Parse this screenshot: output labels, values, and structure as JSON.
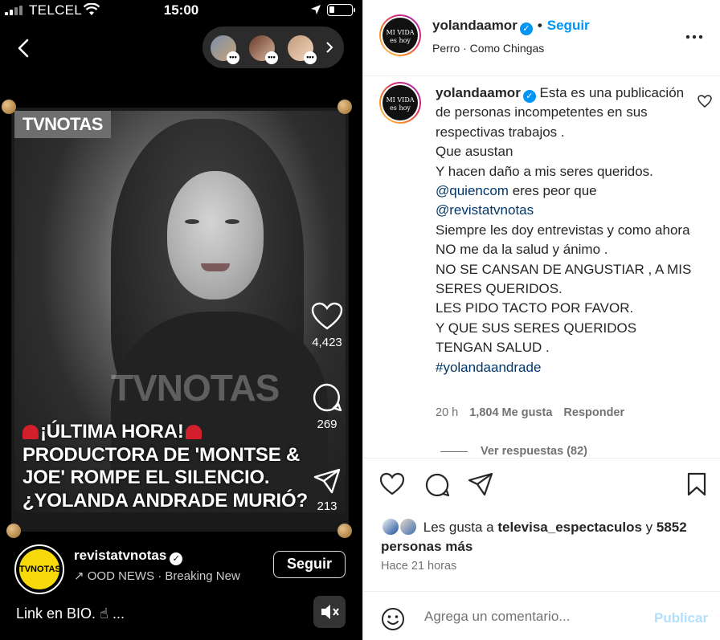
{
  "status_bar": {
    "carrier": "TELCEL",
    "time": "15:00"
  },
  "reel": {
    "poster_logo": "TVNOTAS",
    "watermark": "TVNOTAS",
    "headline_line1": "¡ÚLTIMA HORA!",
    "headline_line2": "PRODUCTORA DE 'MONTSE &",
    "headline_line3": "JOE' ROMPE EL SILENCIO.",
    "headline_line4": "¿YOLANDA ANDRADE MURIÓ?",
    "likes": "4,423",
    "comments": "269",
    "shares": "213",
    "author": "revistatvnotas",
    "author_avatar_text": "TVNOTAS",
    "audio": "↗ OOD NEWS · Breaking New",
    "follow": "Seguir",
    "caption": "Link en BIO. ☝ ...",
    "viewer_dots": "•••"
  },
  "post": {
    "username": "yolandaamor",
    "follow": "Seguir",
    "audio": "Perro · Como Chingas",
    "avatar_text": "MI VIDA es hoy",
    "caption": {
      "user": "yolandaamor",
      "line1": "Esta es una publicación de personas incompetentes en sus respectivas trabajos .",
      "line2": "Que asustan",
      "line3": "Y hacen daño a mis seres queridos.",
      "mention1": "@quiencom",
      "line4": " eres peor que",
      "mention2": "@revistatvnotas",
      "line5": "Siempre les doy entrevistas y como ahora NO me da la salud y ánimo .",
      "line6": "NO SE CANSAN DE ANGUSTIAR , A MIS SERES QUERIDOS.",
      "line7": "LES PIDO TACTO POR FAVOR.",
      "line8": "Y QUE SUS SERES QUERIDOS TENGAN SALUD .",
      "hashtag": "#yolandaandrade"
    },
    "comment_time": "20 h",
    "comment_likes": "1,804 Me gusta",
    "reply": "Responder",
    "view_replies": "Ver respuestas (82)",
    "likes_prefix": "Les gusta a ",
    "likes_user": "televisa_espectaculos",
    "likes_middle": " y ",
    "likes_count": "5852 personas más",
    "time_ago": "Hace 21 horas",
    "comment_placeholder": "Agrega un comentario...",
    "publish": "Publicar"
  },
  "colors": {
    "brand_blue": "#0095f6",
    "link": "#00376b",
    "muted": "#737373"
  }
}
